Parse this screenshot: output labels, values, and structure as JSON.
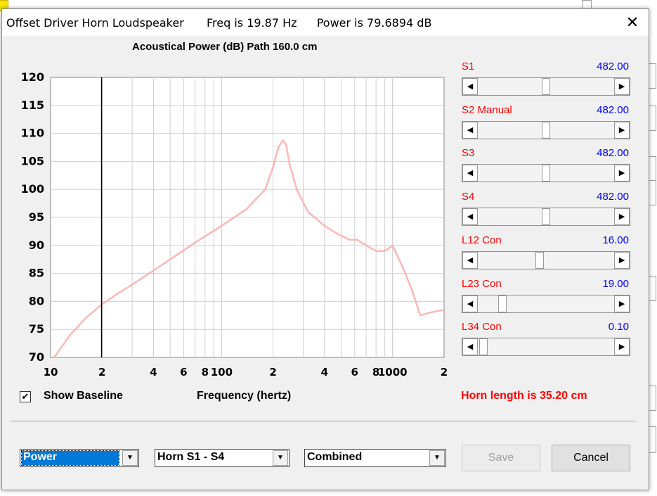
{
  "window": {
    "title": "Offset Driver Horn Loudspeaker",
    "freq_text": "Freq is 19.87 Hz",
    "power_text": "Power is 79.6894 dB",
    "close_glyph": "✕"
  },
  "chart_title": "Acoustical Power (dB)   Path 160.0 cm",
  "sliders": [
    {
      "label": "S1",
      "value": "482.00",
      "position": 0.5
    },
    {
      "label": "S2  Manual",
      "value": "482.00",
      "position": 0.5
    },
    {
      "label": "S3",
      "value": "482.00",
      "position": 0.5
    },
    {
      "label": "S4",
      "value": "482.00",
      "position": 0.5
    },
    {
      "label": "L12  Con",
      "value": "16.00",
      "position": 0.45
    },
    {
      "label": "L23  Con",
      "value": "19.00",
      "position": 0.16
    },
    {
      "label": "L34  Con",
      "value": "0.10",
      "position": 0.01
    }
  ],
  "show_baseline": {
    "label": "Show Baseline",
    "checked": true,
    "check_glyph": "✔"
  },
  "x_axis_label": "Frequency (hertz)",
  "horn_length_text": "Horn length is 35.20 cm",
  "combos": {
    "mode": "Power",
    "horn": "Horn S1 - S4",
    "combine": "Combined"
  },
  "buttons": {
    "save": "Save",
    "cancel": "Cancel"
  },
  "colors": {
    "curve": "#ffb6b6",
    "label_red": "#ff0000",
    "value_blue": "#0000ff",
    "selected_bg": "#0078d7"
  },
  "chart_data": {
    "type": "line",
    "x_scale": "log",
    "xlim": [
      10,
      2000
    ],
    "ylim": [
      70,
      120
    ],
    "yticks": [
      70,
      75,
      80,
      85,
      90,
      95,
      100,
      105,
      110,
      115,
      120
    ],
    "xtick_labels": [
      {
        "x": 10,
        "label": "10"
      },
      {
        "x": 20,
        "label": "2"
      },
      {
        "x": 40,
        "label": "4"
      },
      {
        "x": 60,
        "label": "6"
      },
      {
        "x": 80,
        "label": "8"
      },
      {
        "x": 100,
        "label": "100"
      },
      {
        "x": 200,
        "label": "2"
      },
      {
        "x": 400,
        "label": "4"
      },
      {
        "x": 600,
        "label": "6"
      },
      {
        "x": 800,
        "label": "8"
      },
      {
        "x": 1000,
        "label": "1000"
      },
      {
        "x": 2000,
        "label": "2"
      }
    ],
    "marker_frequency": 19.87,
    "series": [
      {
        "x": [
          10.5,
          13,
          16,
          20,
          25,
          30,
          40,
          50,
          70,
          100,
          140,
          180,
          200,
          215,
          228,
          238,
          250,
          275,
          320,
          400,
          480,
          560,
          620,
          700,
          800,
          900,
          1000,
          1150,
          1300,
          1450,
          1650,
          2000
        ],
        "y": [
          70,
          74,
          77,
          79.5,
          81.5,
          83,
          85.5,
          87.5,
          90.5,
          93.5,
          96.5,
          100,
          104,
          107.5,
          108.8,
          108,
          104.5,
          100,
          96,
          93.5,
          92,
          91,
          91,
          90,
          89,
          89,
          90,
          86,
          82,
          77.5,
          78,
          78.5
        ]
      }
    ]
  }
}
